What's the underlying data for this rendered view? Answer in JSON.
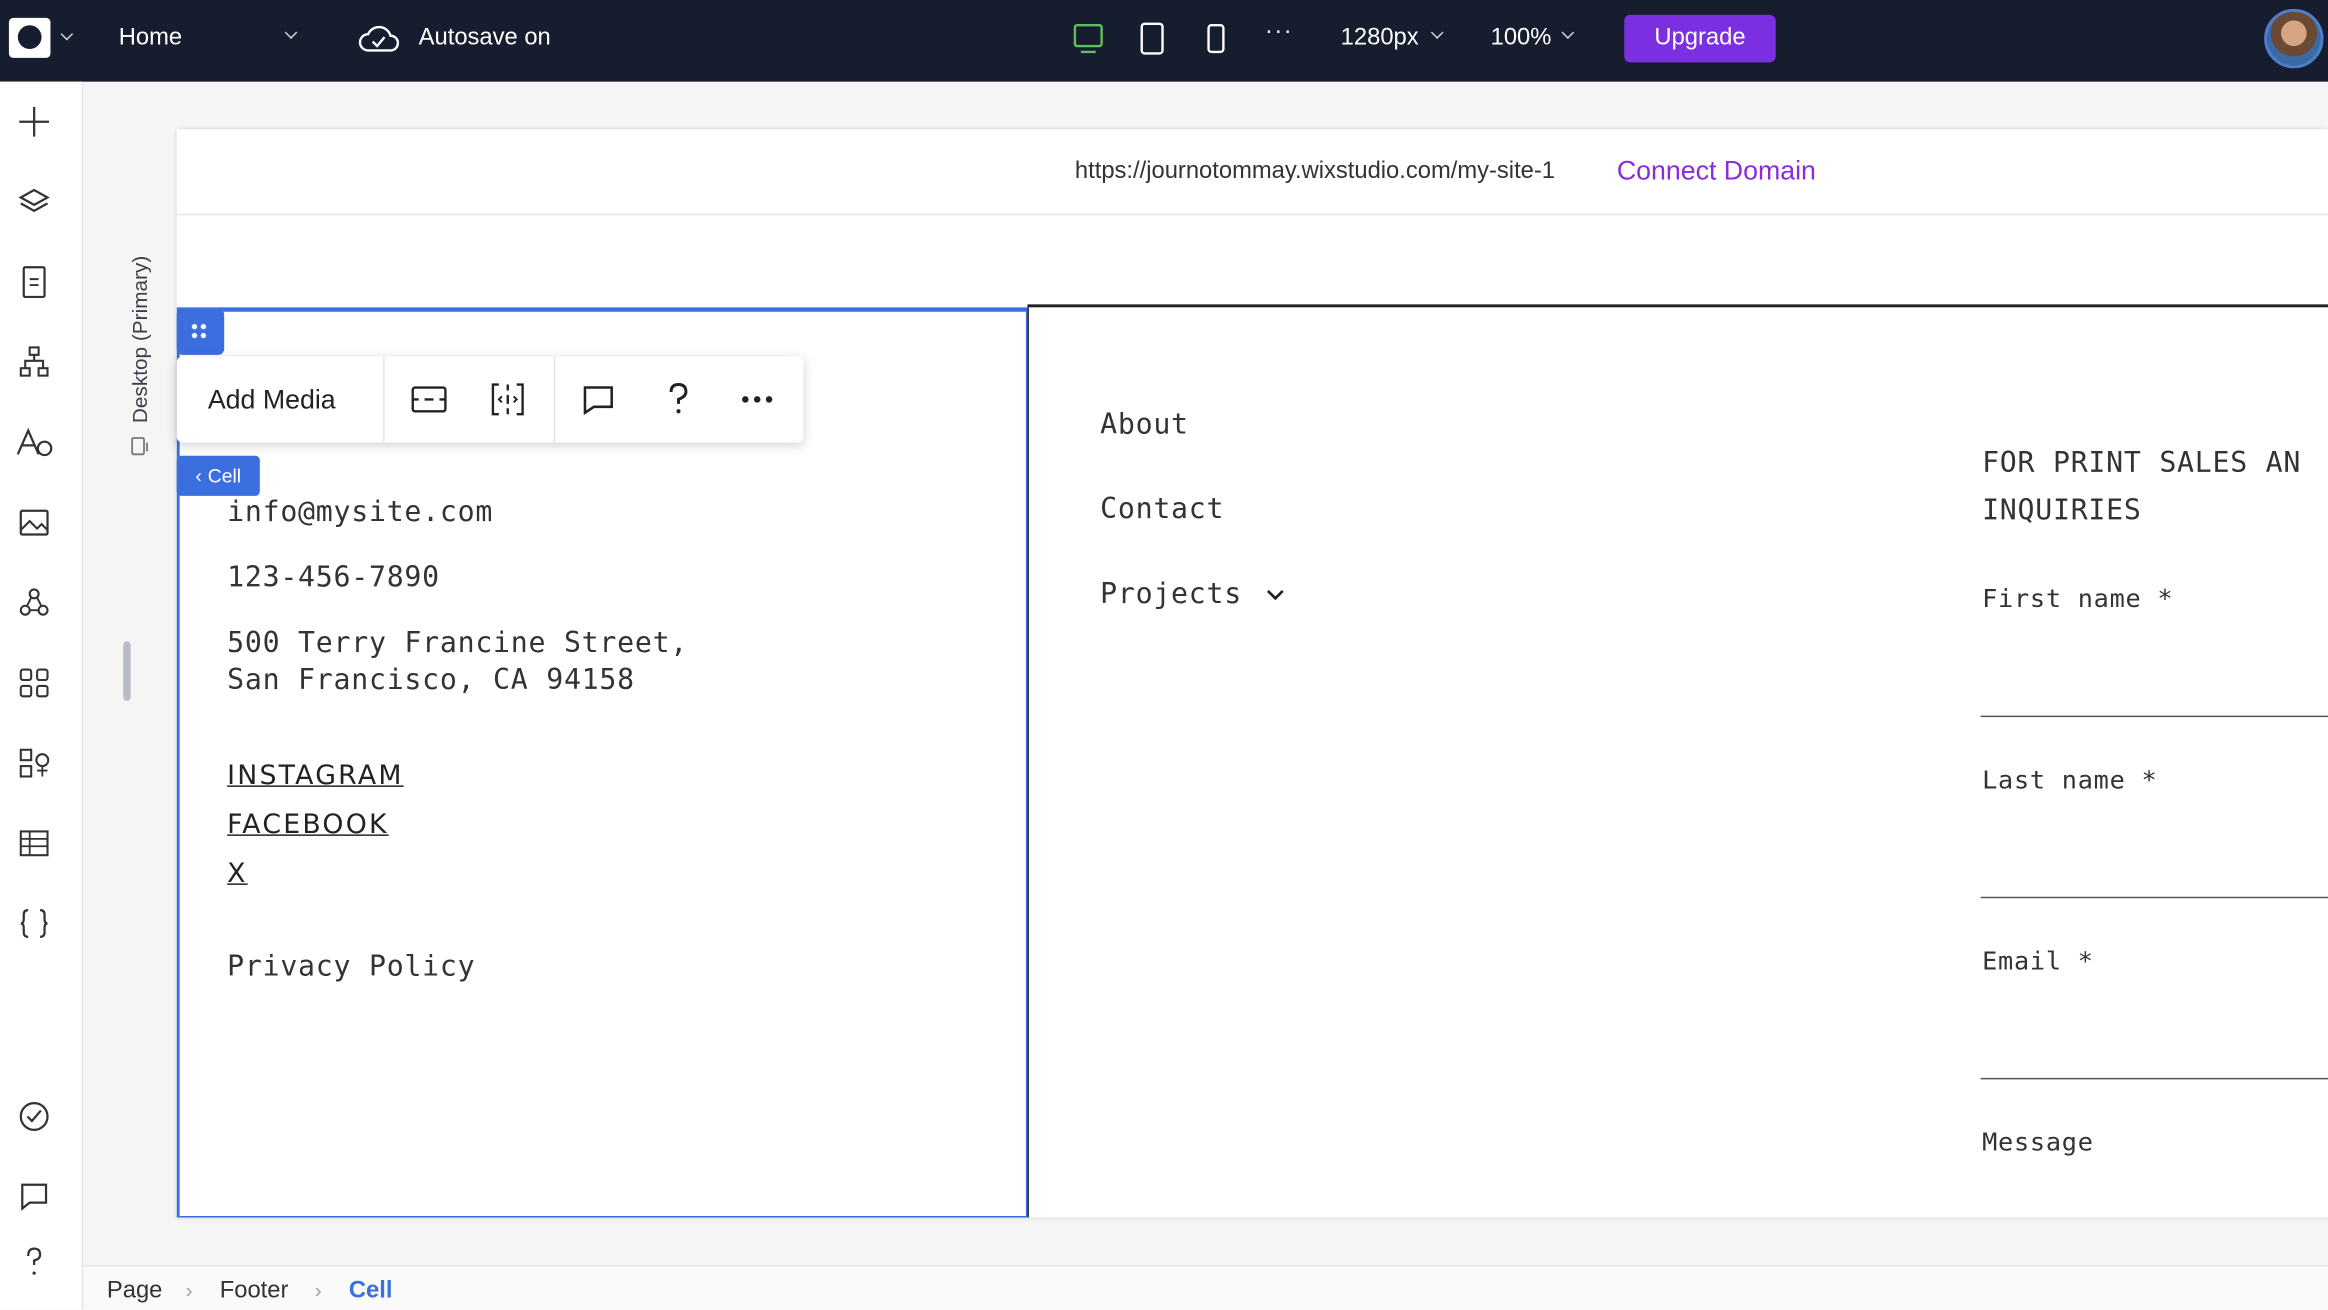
{
  "topbar": {
    "page_name": "Home",
    "autosave": "Autosave on",
    "width_value": "1280px",
    "zoom_value": "100%",
    "upgrade_label": "Upgrade",
    "more_label": "···",
    "accent_color": "#7c2fe0",
    "desktop_icon_color": "#4caf50"
  },
  "side_label": "Desktop (Primary)",
  "canvas": {
    "url": "https://journotommay.wixstudio.com/my-site-1",
    "connect_domain": "Connect Domain"
  },
  "toolbar": {
    "add_media": "Add Media",
    "cell_tag": "Cell"
  },
  "footer_left": {
    "email": "info@mysite.com",
    "phone": "123-456-7890",
    "address_line1": "500 Terry Francine Street,",
    "address_line2": "San Francisco, CA 94158",
    "social": [
      "INSTAGRAM",
      "FACEBOOK",
      "X"
    ],
    "privacy": "Privacy Policy"
  },
  "footer_nav": {
    "items": [
      "About",
      "Contact",
      "Projects"
    ]
  },
  "form": {
    "heading_line1": "FOR PRINT SALES AN",
    "heading_line2": "INQUIRIES",
    "fields": [
      "First name *",
      "Last name *",
      "Email *",
      "Message"
    ]
  },
  "breadcrumb": {
    "items": [
      "Page",
      "Footer",
      "Cell"
    ],
    "active_color": "#3b6fe0"
  }
}
